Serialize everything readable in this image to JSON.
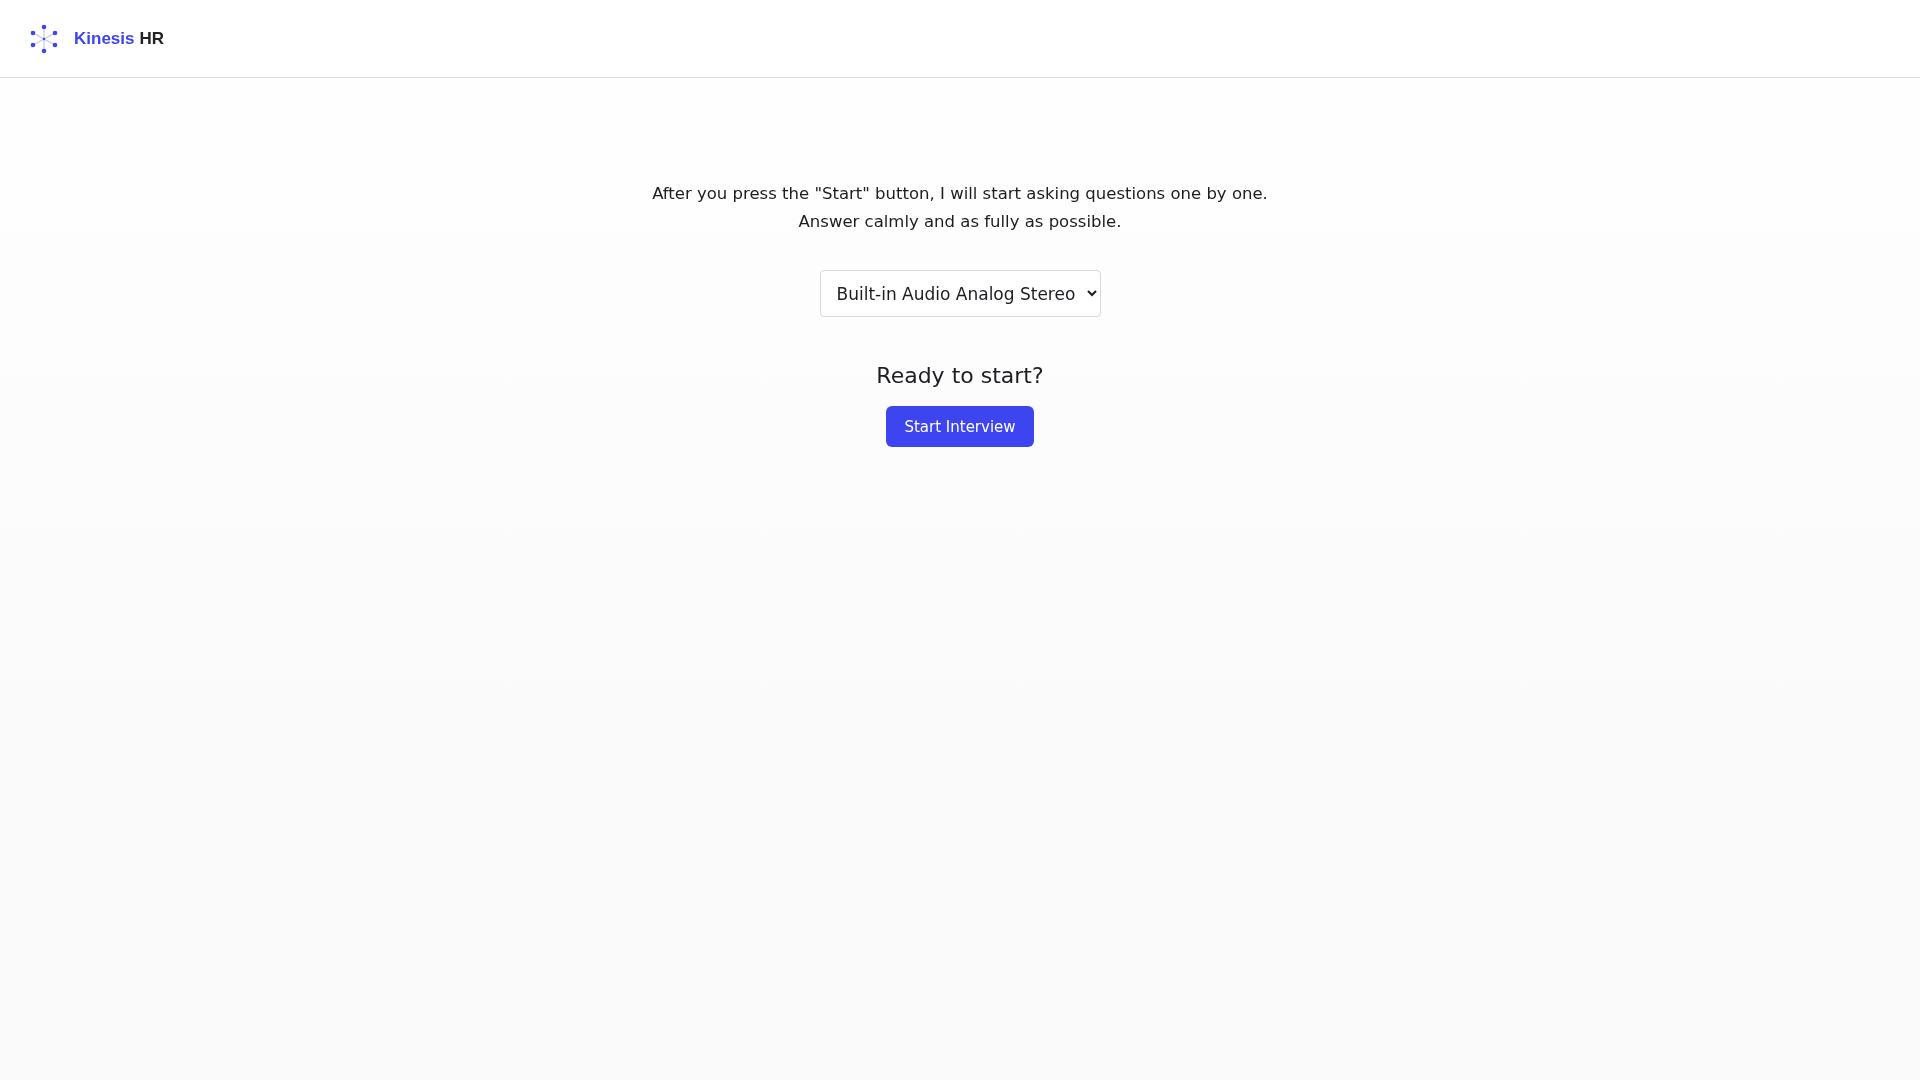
{
  "header": {
    "brand": "Kinesis",
    "brand_suffix": "HR"
  },
  "intro": [
    "After you press the \"Start\" button, I will start asking questions one by one.",
    "Answer calmly and as fully as possible."
  ],
  "device_select": {
    "value": "Built-in Audio Analog Stereo"
  },
  "prompt": "Ready to start?",
  "start_button": "Start Interview"
}
